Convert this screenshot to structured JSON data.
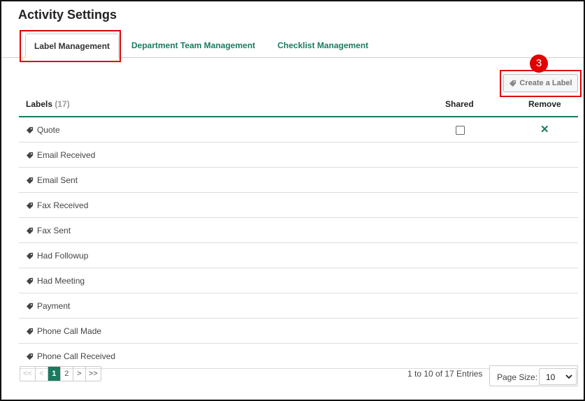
{
  "page": {
    "title": "Activity Settings"
  },
  "tabs": [
    {
      "label": "Label Management",
      "active": true
    },
    {
      "label": "Department Team Management",
      "active": false
    },
    {
      "label": "Checklist Management",
      "active": false
    }
  ],
  "annotation": {
    "step": "3"
  },
  "toolbar": {
    "create_label": "Create a Label"
  },
  "table": {
    "headers": {
      "labels": "Labels",
      "count": "(17)",
      "shared": "Shared",
      "remove": "Remove"
    },
    "rows": [
      {
        "label": "Quote",
        "shared": false,
        "removable": true
      },
      {
        "label": "Email Received"
      },
      {
        "label": "Email Sent"
      },
      {
        "label": "Fax Received"
      },
      {
        "label": "Fax Sent"
      },
      {
        "label": "Had Followup"
      },
      {
        "label": "Had Meeting"
      },
      {
        "label": "Payment"
      },
      {
        "label": "Phone Call Made"
      },
      {
        "label": "Phone Call Received"
      }
    ]
  },
  "pagination": {
    "first": "<<",
    "prev": "<",
    "pages": [
      "1",
      "2"
    ],
    "current": "1",
    "next": ">",
    "last": ">>",
    "entries_text": "1 to 10 of 17 Entries",
    "page_size_label": "Page Size:",
    "page_size_value": "10"
  },
  "colors": {
    "accent": "#1a7a5f",
    "highlight": "#e00000"
  },
  "icons": {
    "label": "tag-icon",
    "remove": "close-icon",
    "dropdown": "chevron-down-icon"
  }
}
